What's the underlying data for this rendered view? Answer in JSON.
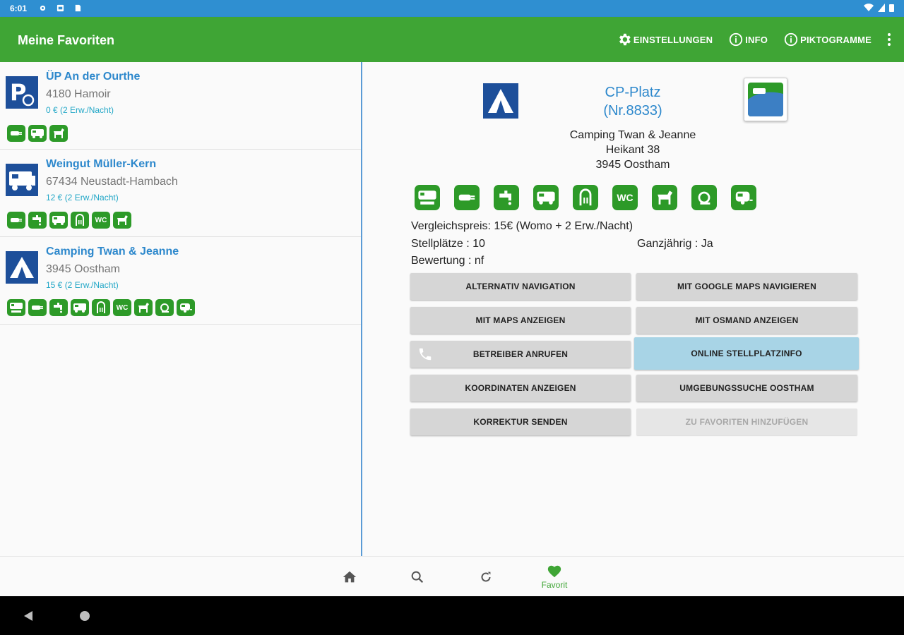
{
  "status_bar": {
    "time": "6:01"
  },
  "app_bar": {
    "title": "Meine Favoriten",
    "actions": {
      "settings": "EINSTELLUNGEN",
      "info": "INFO",
      "pictograms": "PIKTOGRAMME"
    }
  },
  "favorites": [
    {
      "name": "ÜP An der Ourthe",
      "city": "4180 Hamoir",
      "price": "0 € (2 Erw./Nacht)",
      "logo": "parking-camper-logo",
      "icons": [
        "power-icon",
        "water-tap-icon",
        "dog-icon"
      ]
    },
    {
      "name": "Weingut Müller-Kern",
      "city": "67434 Neustadt-Hambach",
      "price": "12 € (2 Erw./Nacht)",
      "logo": "motorhome-logo",
      "icons": [
        "plug-icon",
        "water-tap-icon",
        "camper-service-icon",
        "shower-icon",
        "wc-icon",
        "dog-icon"
      ]
    },
    {
      "name": "Camping Twan & Jeanne",
      "city": "3945 Oostham",
      "price": "15 € (2 Erw./Nacht)",
      "logo": "tent-logo",
      "icons": [
        "camper-dump-icon",
        "plug-icon",
        "water-tap-icon",
        "camper-service-icon",
        "shower-icon",
        "wc-icon",
        "dog-icon",
        "recycle-icon",
        "caravan-icon"
      ]
    }
  ],
  "detail": {
    "type": "CP-Platz",
    "number": "(Nr.8833)",
    "address": [
      "Camping Twan & Jeanne",
      "Heikant 38",
      "3945 Oostham"
    ],
    "icons": [
      "camper-dump-icon",
      "plug-icon",
      "water-tap-icon",
      "camper-service-icon",
      "shower-icon",
      "wc-icon",
      "dog-icon",
      "recycle-icon",
      "caravan-icon"
    ],
    "wc_text": "WC",
    "compare_price": "Vergleichspreis: 15€ (Womo + 2 Erw./Nacht)",
    "spaces": "Stellplätze : 10",
    "all_year": "Ganzjährig : Ja",
    "rating": "Bewertung : nf",
    "buttons": {
      "alt_nav": "ALTERNATIV NAVIGATION",
      "google_nav": "MIT GOOGLE MAPS NAVIGIEREN",
      "maps_show": "MIT MAPS ANZEIGEN",
      "osmand_show": "MIT OSMAND ANZEIGEN",
      "call": "BETREIBER ANRUFEN",
      "online_info": "ONLINE STELLPLATZINFO",
      "coords": "KOORDINATEN ANZEIGEN",
      "nearby": "UMGEBUNGSSUCHE OOSTHAM",
      "correction": "KORREKTUR SENDEN",
      "add_fav": "ZU FAVORITEN HINZUFÜGEN"
    }
  },
  "bottom_nav": {
    "favorite_label": "Favorit"
  },
  "colors": {
    "app_bar": "#3fa535",
    "status_bar": "#2f8fd1",
    "link": "#2d88cc",
    "price": "#22a7c7",
    "pictogram": "#2d9a28",
    "highlight": "#a8d4e6"
  }
}
